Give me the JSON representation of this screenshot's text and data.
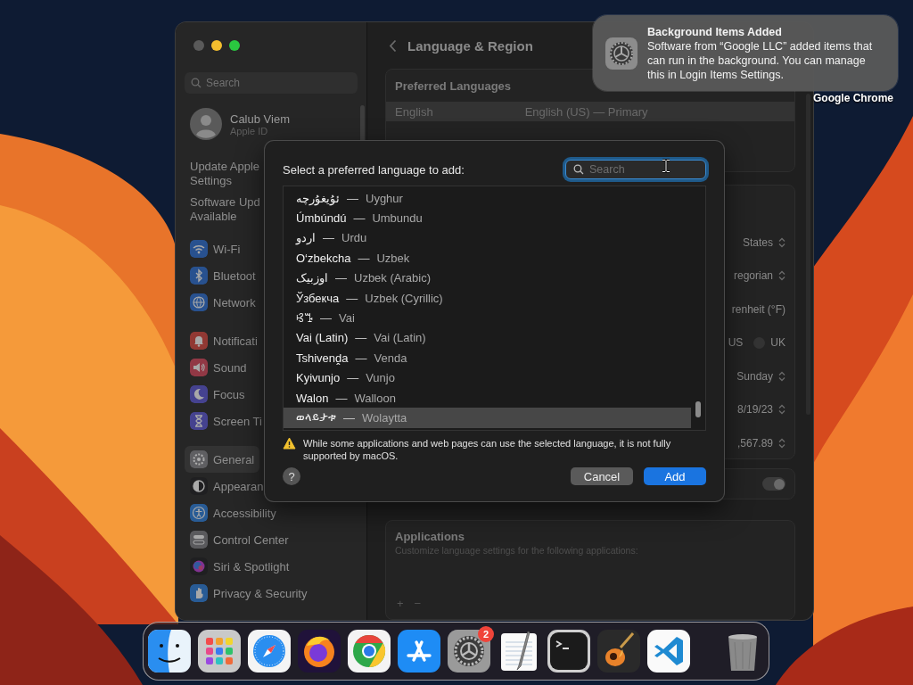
{
  "settings_window": {
    "sidebar": {
      "search": {
        "placeholder": "Search"
      },
      "account": {
        "name": "Calub Viem",
        "subtitle": "Apple ID"
      },
      "notices": [
        {
          "lines": [
            "Update Apple",
            "Settings"
          ]
        },
        {
          "lines": [
            "Software Upd",
            "Available"
          ]
        }
      ],
      "groups": [
        {
          "items": [
            {
              "kind": "wifi",
              "label": "Wi-Fi",
              "selected": false
            },
            {
              "kind": "bluetooth",
              "label": "Bluetoot",
              "selected": false
            },
            {
              "kind": "network",
              "label": "Network",
              "selected": false
            }
          ]
        },
        {
          "items": [
            {
              "kind": "notifications",
              "label": "Notificati",
              "selected": false
            },
            {
              "kind": "sound",
              "label": "Sound",
              "selected": false
            },
            {
              "kind": "focus",
              "label": "Focus",
              "selected": false
            },
            {
              "kind": "screentime",
              "label": "Screen Ti",
              "selected": false
            }
          ]
        },
        {
          "items": [
            {
              "kind": "general",
              "label": "General",
              "selected": true
            },
            {
              "kind": "appearance",
              "label": "Appearan",
              "selected": false
            },
            {
              "kind": "accessibility",
              "label": "Accessibility",
              "selected": false
            },
            {
              "kind": "control",
              "label": "Control Center",
              "selected": false
            },
            {
              "kind": "siri",
              "label": "Siri & Spotlight",
              "selected": false
            },
            {
              "kind": "privacy",
              "label": "Privacy & Security",
              "selected": false
            }
          ]
        }
      ]
    },
    "content": {
      "title": "Language & Region",
      "preferred_languages": {
        "header": "Preferred Languages",
        "rows": [
          {
            "name": "English",
            "detail": "English (US) — Primary",
            "selected": true
          }
        ]
      },
      "format_rows": [
        {
          "kind": "popup",
          "value": "States"
        },
        {
          "kind": "popup",
          "value": "regorian"
        },
        {
          "kind": "text",
          "value": "renheit (°F)"
        },
        {
          "kind": "radio",
          "value": "US",
          "option": "UK",
          "option_selected": false
        },
        {
          "kind": "popup",
          "value": "Sunday"
        },
        {
          "kind": "popup",
          "value": "8/19/23"
        },
        {
          "kind": "popup",
          "value": ",567.89"
        }
      ],
      "toggle": {
        "on": true
      },
      "applications": {
        "header": "Applications",
        "description": "Customize language settings for the following applications:",
        "buttons": [
          "+",
          "−"
        ]
      }
    }
  },
  "language_dialog": {
    "title": "Select a preferred language to add:",
    "search": {
      "placeholder": "Search",
      "focused": true
    },
    "languages": [
      {
        "native": "ئۇيغۇرچە",
        "dash": "—",
        "english": "Uyghur",
        "selected": false
      },
      {
        "native": "Úmbúndú",
        "dash": "—",
        "english": "Umbundu",
        "selected": false
      },
      {
        "native": "اردو",
        "dash": "—",
        "english": "Urdu",
        "selected": false
      },
      {
        "native": "O‘zbekcha",
        "dash": "—",
        "english": "Uzbek",
        "selected": false
      },
      {
        "native": "اوزبیک",
        "dash": "—",
        "english": "Uzbek (Arabic)",
        "selected": false
      },
      {
        "native": "Ўзбекча",
        "dash": "—",
        "english": "Uzbek (Cyrillic)",
        "selected": false
      },
      {
        "native": "ꕙꔤ",
        "dash": "—",
        "english": "Vai",
        "selected": false
      },
      {
        "native": "Vai (Latin)",
        "dash": "—",
        "english": "Vai (Latin)",
        "selected": false
      },
      {
        "native": "Tshivenḓa",
        "dash": "—",
        "english": "Venda",
        "selected": false
      },
      {
        "native": "Kyivunjo",
        "dash": "—",
        "english": "Vunjo",
        "selected": false
      },
      {
        "native": "Walon",
        "dash": "—",
        "english": "Walloon",
        "selected": false
      },
      {
        "native": "ወላይታቱ",
        "dash": "—",
        "english": "Wolaytta",
        "selected": true
      }
    ],
    "warning": "While some applications and web pages can use the selected language, it is not fully supported by macOS.",
    "help": "?",
    "buttons": [
      {
        "label": "Cancel",
        "kind": "secondary"
      },
      {
        "label": "Add",
        "kind": "primary"
      }
    ]
  },
  "notification": {
    "title": "Background Items Added",
    "body": "Software from “Google LLC” added items that can run in the background. You can manage this in Login Items Settings."
  },
  "desktop_label": "Google Chrome",
  "dock": {
    "apps": [
      {
        "kind": "finder"
      },
      {
        "kind": "launchpad"
      },
      {
        "kind": "safari"
      },
      {
        "kind": "firefox"
      },
      {
        "kind": "chrome"
      },
      {
        "kind": "appstore"
      },
      {
        "kind": "settings",
        "badge": "2"
      },
      {
        "kind": "textedit"
      },
      {
        "kind": "terminal"
      },
      {
        "kind": "garageband"
      },
      {
        "kind": "vscode"
      },
      {
        "kind": "trash"
      }
    ]
  }
}
